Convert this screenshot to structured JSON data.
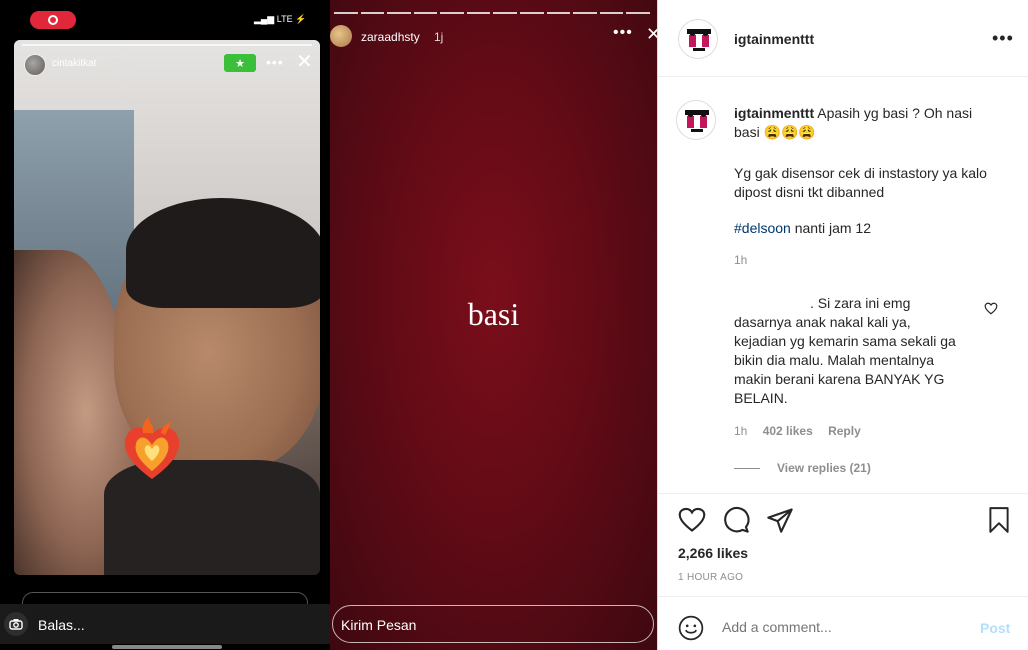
{
  "story_left": {
    "username": "cintakitkat",
    "time": "21m",
    "status_right": "LTE",
    "reply_placeholder": "Balas..."
  },
  "story_middle": {
    "username": "zaraadhsty",
    "time": "1j",
    "center_text": "basi",
    "message_placeholder": "Kirim Pesan"
  },
  "post": {
    "username": "igtainmenttt",
    "caption_line1": "Apasih yg basi ? Oh nasi basi 😩😩😩",
    "caption_line2": "Yg gak disensor cek di instastory ya kalo dipost disni tkt dibanned",
    "hashtag": "#delsoon",
    "hashtag_rest": " nanti jam 12",
    "caption_time": "1h",
    "comment": {
      "text": ". Si zara ini emg dasarnya anak nakal kali ya, kejadian yg kemarin sama sekali ga bikin dia malu. Malah mentalnya makin berani karena BANYAK YG BELAIN.",
      "time": "1h",
      "likes": "402 likes",
      "reply": "Reply",
      "view_replies": "View replies (21)"
    },
    "likes": "2,266 likes",
    "post_time": "1 HOUR AGO",
    "add_comment_placeholder": "Add a comment...",
    "post_button": "Post"
  },
  "icons": {
    "heart": "heart-icon",
    "comment": "comment-icon",
    "share": "paper-plane-icon",
    "save": "bookmark-icon",
    "emoji": "smile-icon"
  }
}
